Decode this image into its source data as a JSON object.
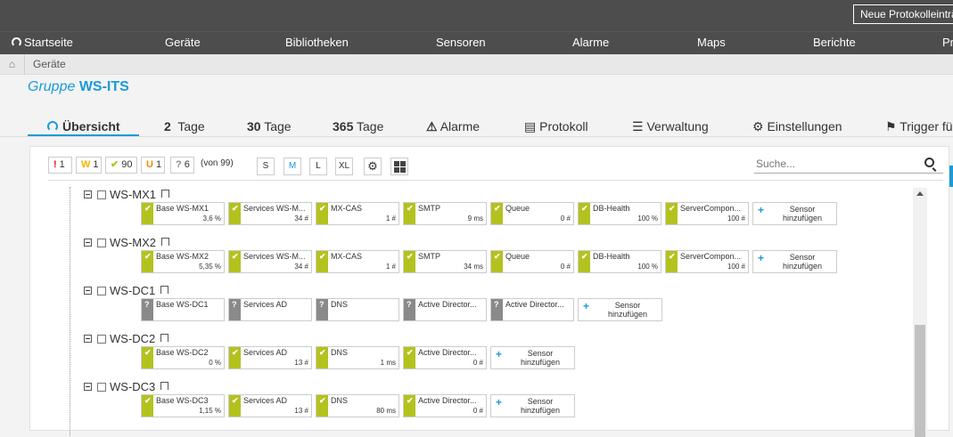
{
  "topbar": {
    "new_log_button": "Neue Protokolleinträg"
  },
  "nav": {
    "home": "Startseite",
    "items": [
      "Geräte",
      "Bibliotheken",
      "Sensoren",
      "Alarme",
      "Maps",
      "Berichte",
      "Pr"
    ]
  },
  "breadcrumb": {
    "current": "Geräte"
  },
  "group": {
    "prefix": "Gruppe",
    "name": "WS-ITS"
  },
  "tabs": {
    "overview": "Übersicht",
    "days2_num": "2",
    "days2_label": "Tage",
    "days30_num": "30",
    "days30_label": "Tage",
    "days365_num": "365",
    "days365_label": "Tage",
    "alarms": "Alarme",
    "log": "Protokoll",
    "management": "Verwaltung",
    "settings": "Einstellungen",
    "trigger": "Trigger fü"
  },
  "status": {
    "down": {
      "sym": "!",
      "count": "1",
      "color": "#d71920"
    },
    "warning": {
      "sym": "W",
      "count": "1",
      "color": "#f0b400"
    },
    "up": {
      "sym": "✔",
      "count": "90",
      "color": "#b4c21e"
    },
    "unusual": {
      "sym": "U",
      "count": "1",
      "color": "#f08a00"
    },
    "unknown": {
      "sym": "?",
      "count": "6",
      "color": "#8a8a8a"
    },
    "total": "(von 99)"
  },
  "sizes": [
    "S",
    "M",
    "L",
    "XL"
  ],
  "search": {
    "placeholder": "Suche..."
  },
  "add_sensor_label": "Sensor hinzufügen",
  "devices": [
    {
      "name": "WS-MX1",
      "sensors": [
        {
          "name": "Base WS-MX1",
          "value": "3,6 %",
          "status": "up"
        },
        {
          "name": "Services WS-M...",
          "value": "34 #",
          "status": "up"
        },
        {
          "name": "MX-CAS",
          "value": "1 #",
          "status": "up"
        },
        {
          "name": "SMTP",
          "value": "9 ms",
          "status": "up"
        },
        {
          "name": "Queue",
          "value": "0 #",
          "status": "up"
        },
        {
          "name": "DB-Health",
          "value": "100 %",
          "status": "up"
        },
        {
          "name": "ServerCompon...",
          "value": "100 #",
          "status": "up"
        }
      ]
    },
    {
      "name": "WS-MX2",
      "sensors": [
        {
          "name": "Base WS-MX2",
          "value": "5,35 %",
          "status": "up"
        },
        {
          "name": "Services WS-M...",
          "value": "34 #",
          "status": "up"
        },
        {
          "name": "MX-CAS",
          "value": "1 #",
          "status": "up"
        },
        {
          "name": "SMTP",
          "value": "34 ms",
          "status": "up"
        },
        {
          "name": "Queue",
          "value": "0 #",
          "status": "up"
        },
        {
          "name": "DB-Health",
          "value": "100 %",
          "status": "up"
        },
        {
          "name": "ServerCompon...",
          "value": "100 #",
          "status": "up"
        }
      ]
    },
    {
      "name": "WS-DC1",
      "sensors": [
        {
          "name": "Base WS-DC1",
          "value": "",
          "status": "unknown"
        },
        {
          "name": "Services AD",
          "value": "",
          "status": "unknown"
        },
        {
          "name": "DNS",
          "value": "",
          "status": "unknown"
        },
        {
          "name": "Active Director...",
          "value": "",
          "status": "unknown"
        },
        {
          "name": "Active Director...",
          "value": "",
          "status": "unknown"
        }
      ]
    },
    {
      "name": "WS-DC2",
      "sensors": [
        {
          "name": "Base WS-DC2",
          "value": "0 %",
          "status": "up"
        },
        {
          "name": "Services AD",
          "value": "13 #",
          "status": "up"
        },
        {
          "name": "DNS",
          "value": "1 ms",
          "status": "up"
        },
        {
          "name": "Active Director...",
          "value": "0 #",
          "status": "up"
        }
      ]
    },
    {
      "name": "WS-DC3",
      "sensors": [
        {
          "name": "Base WS-DC3",
          "value": "1,15 %",
          "status": "up"
        },
        {
          "name": "Services AD",
          "value": "13 #",
          "status": "up"
        },
        {
          "name": "DNS",
          "value": "80 ms",
          "status": "up"
        },
        {
          "name": "Active Director...",
          "value": "0 #",
          "status": "up"
        }
      ]
    }
  ]
}
